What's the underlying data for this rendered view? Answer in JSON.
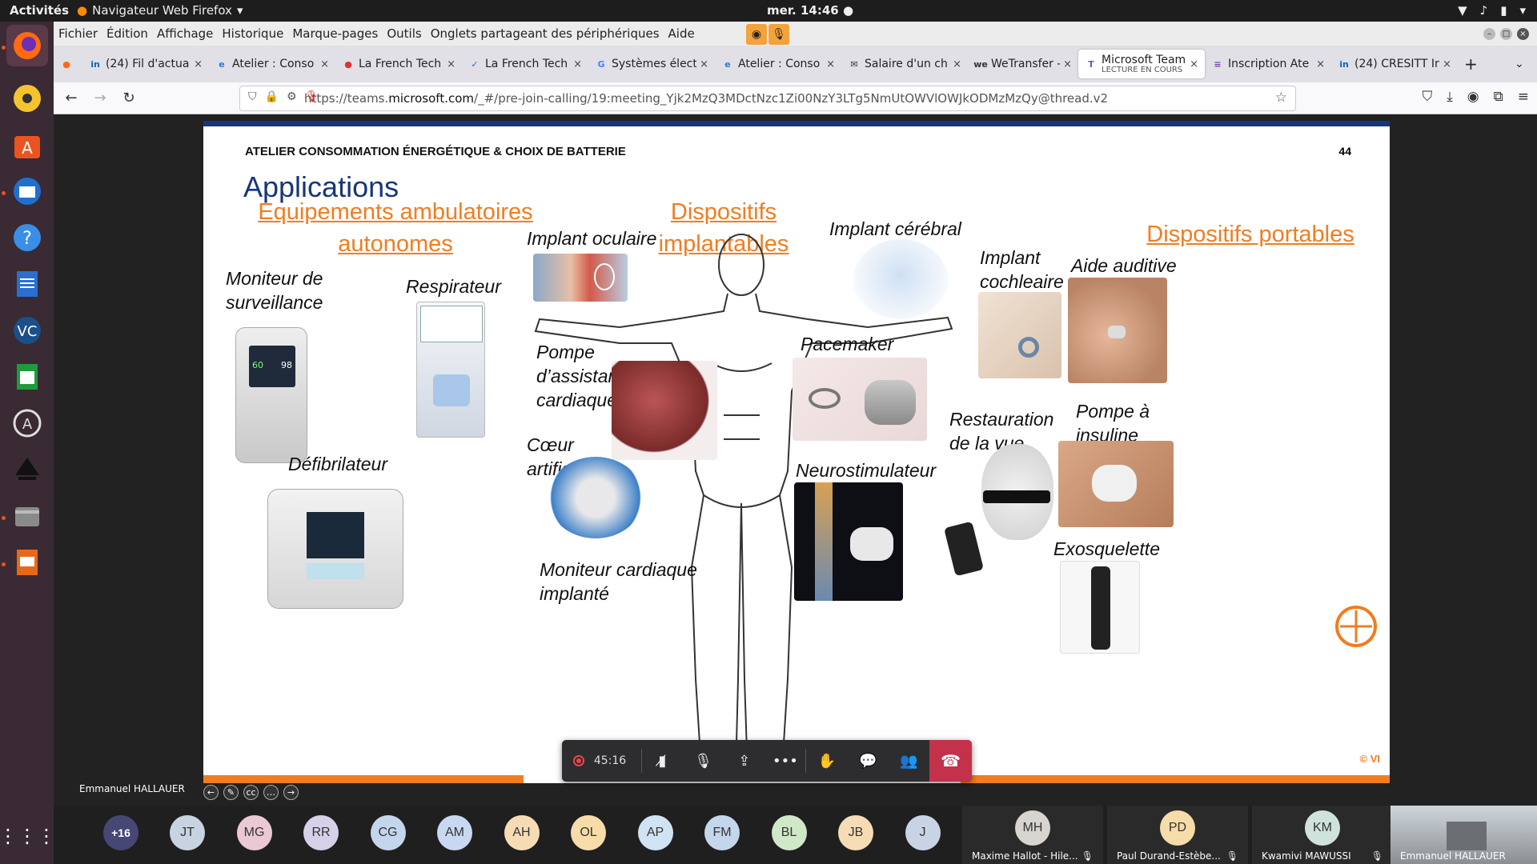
{
  "topbar": {
    "activities": "Activités",
    "app_name": "Navigateur Web Firefox",
    "clock": "mer. 14:46"
  },
  "menubar": {
    "items": [
      "Fichier",
      "Édition",
      "Affichage",
      "Historique",
      "Marque-pages",
      "Outils",
      "Onglets partageant des périphériques",
      "Aide"
    ]
  },
  "tabs": [
    {
      "label": "(24) Fil d'actua",
      "icon": "linkedin-icon",
      "icon_text": "in",
      "icon_color": "#0a66c2"
    },
    {
      "label": "Atelier : Conso",
      "icon": "edge-icon",
      "icon_text": "e",
      "icon_color": "#2b7bd6"
    },
    {
      "label": "La French Tech",
      "icon": "pin-icon",
      "icon_text": "●",
      "icon_color": "#d33"
    },
    {
      "label": "La French Tech",
      "icon": "check-icon",
      "icon_text": "✓",
      "icon_color": "#2f6fd1"
    },
    {
      "label": "Systèmes élect",
      "icon": "google-icon",
      "icon_text": "G",
      "icon_color": "#4285f4"
    },
    {
      "label": "Atelier : Conso",
      "icon": "edge-icon",
      "icon_text": "e",
      "icon_color": "#2b7bd6"
    },
    {
      "label": "Salaire d'un ch",
      "icon": "mail-icon",
      "icon_text": "✉",
      "icon_color": "#333"
    },
    {
      "label": "WeTransfer - S",
      "icon": "wetransfer-icon",
      "icon_text": "we",
      "icon_color": "#333"
    },
    {
      "label": "Microsoft Team",
      "subtitle": "LECTURE EN COURS",
      "icon": "teams-icon",
      "icon_text": "T",
      "icon_color": "#5b5fc7",
      "active": true
    },
    {
      "label": "Inscription Ate",
      "icon": "form-icon",
      "icon_text": "≡",
      "icon_color": "#7a3fb0"
    },
    {
      "label": "(24) CRESITT In",
      "icon": "linkedin-icon",
      "icon_text": "in",
      "icon_color": "#0a66c2"
    }
  ],
  "url": {
    "prefix": "https://teams.",
    "domain": "microsoft.com",
    "rest": "/_#/pre-join-calling/19:meeting_Yjk2MzQ3MDctNzc1Zi00NzY3LTg5NmUtOWVlOWJkODMzMzQy@thread.v2"
  },
  "slide": {
    "header": "ATELIER CONSOMMATION ÉNERGÉTIQUE & CHOIX DE BATTERIE",
    "page": "44",
    "title": "Applications",
    "sections": {
      "ambulatory": "Equipements ambulatoires autonomes",
      "implantable": "Dispositifs implantables",
      "portable": "Dispositifs portables"
    },
    "labels": {
      "monitor": "Moniteur de surveillance",
      "respirator": "Respirateur",
      "defibrillator": "Défibrilateur",
      "eye_implant": "Implant oculaire",
      "brain_implant": "Implant cérébral",
      "heart_pump": "Pompe d’assistance cardiaque",
      "pacemaker": "Pacemaker",
      "artificial_heart": "Cœur artificiel",
      "neurostim": "Neurostimulateur",
      "cardiac_monitor": "Moniteur cardiaque implanté",
      "cochlear": "Implant cochleaire",
      "hearing_aid": "Aide auditive",
      "vision": "Restauration de la vue",
      "insulin": "Pompe à insuline",
      "exoskeleton": "Exosquelette"
    },
    "monitor_readout": {
      "left": "60",
      "right": "98"
    },
    "copyright": "© VI"
  },
  "presenter": "Emmanuel HALLAUER",
  "controls": {
    "timer": "45:16"
  },
  "participants": {
    "more": "+16",
    "avatars": [
      {
        "initials": "JT",
        "color": "#c7d3e0"
      },
      {
        "initials": "MG",
        "color": "#eac9d4"
      },
      {
        "initials": "RR",
        "color": "#d6d0e8"
      },
      {
        "initials": "CG",
        "color": "#c3d6ec"
      },
      {
        "initials": "AM",
        "color": "#c8d8f0"
      },
      {
        "initials": "AH",
        "color": "#f6dcb4"
      },
      {
        "initials": "OL",
        "color": "#f6dca8"
      },
      {
        "initials": "AP",
        "color": "#cfe3f3"
      },
      {
        "initials": "FM",
        "color": "#c3d6ec"
      },
      {
        "initials": "BL",
        "color": "#cfe8c8"
      },
      {
        "initials": "JB",
        "color": "#f6dcb4"
      },
      {
        "initials": "J",
        "color": "#c8d4e6"
      }
    ],
    "tiles": [
      {
        "initials": "MH",
        "name": "Maxime Hallot - Hile...",
        "color": "#d8d4d0"
      },
      {
        "initials": "PD",
        "name": "Paul Durand-Estèbe...",
        "color": "#f6dca8"
      },
      {
        "initials": "KM",
        "name": "Kwamivi MAWUSSI",
        "color": "#cfe3dc"
      }
    ],
    "video_name": "Emmanuel HALLAUER"
  }
}
